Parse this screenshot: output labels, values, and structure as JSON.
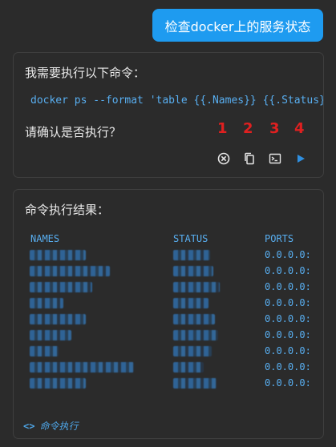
{
  "user_message": "检查docker上的服务状态",
  "confirm_card": {
    "intro": "我需要执行以下命令：",
    "command": "docker ps --format 'table {{.Names}} {{.Status}}\\t{{.Ports}}'",
    "prompt": "请确认是否执行？",
    "annotations": [
      "1",
      "2",
      "3",
      "4"
    ],
    "actions": [
      {
        "icon": "cancel-icon"
      },
      {
        "icon": "copy-icon"
      },
      {
        "icon": "terminal-icon"
      },
      {
        "icon": "run-icon"
      }
    ]
  },
  "result_card": {
    "title": "命令执行结果：",
    "headers": {
      "names": "NAMES",
      "status": "STATUS",
      "ports": "PORTS"
    },
    "ports": [
      "0.0.0.0:",
      "0.0.0.0:",
      "0.0.0.0:",
      "0.0.0.0:",
      "0.0.0.0:",
      "0.0.0.0:",
      "0.0.0.0:",
      "0.0.0.0:",
      "0.0.0.0:"
    ],
    "footer": "命令执行",
    "footer_icon": "<>"
  },
  "colors": {
    "background": "#2b2b2b",
    "user_bubble": "#1e9bf0",
    "code_text": "#58aef0",
    "annotation": "#e02020"
  }
}
